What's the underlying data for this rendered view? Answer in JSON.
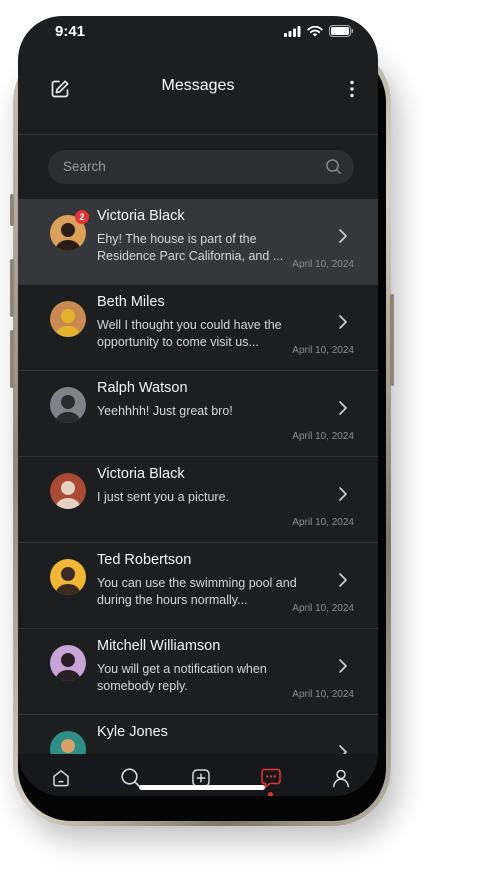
{
  "status_bar": {
    "time": "9:41"
  },
  "header": {
    "title": "Messages"
  },
  "search": {
    "placeholder": "Search"
  },
  "conversations": [
    {
      "name": "Victoria Black",
      "message": "Ehy! The house is part of the Residence Parc California, and ...",
      "date": "April 10, 2024",
      "unread": "2",
      "active": true,
      "avatar_bg": "#d9a15a",
      "avatar_fg": "#2b1d17"
    },
    {
      "name": "Beth Miles",
      "message": "Well I thought you could have the opportunity to come visit us...",
      "date": "April 10, 2024",
      "unread": "",
      "active": false,
      "avatar_bg": "#c98a52",
      "avatar_fg": "#e6b32f"
    },
    {
      "name": "Ralph Watson",
      "message": "Yeehhhh! Just great bro!",
      "date": "April 10, 2024",
      "unread": "",
      "active": false,
      "avatar_bg": "#7f8287",
      "avatar_fg": "#2a2b2e"
    },
    {
      "name": "Victoria Black",
      "message": "I just sent you a picture.",
      "date": "April 10, 2024",
      "unread": "",
      "active": false,
      "avatar_bg": "#a84a35",
      "avatar_fg": "#e5d2c3"
    },
    {
      "name": "Ted Robertson",
      "message": "You can use the swimming pool and during the hours normally...",
      "date": "April 10, 2024",
      "unread": "",
      "active": false,
      "avatar_bg": "#f0b735",
      "avatar_fg": "#3a2b22"
    },
    {
      "name": "Mitchell Williamson",
      "message": "You will get a notification when somebody reply.",
      "date": "April 10, 2024",
      "unread": "",
      "active": false,
      "avatar_bg": "#c7a5d9",
      "avatar_fg": "#2b1f25"
    },
    {
      "name": "Kyle Jones",
      "message": "",
      "date": "",
      "unread": "",
      "active": false,
      "avatar_bg": "#2f8f88",
      "avatar_fg": "#d8a16a"
    }
  ],
  "bottom_nav": [
    {
      "icon": "home-icon",
      "active": false
    },
    {
      "icon": "search-icon",
      "active": false
    },
    {
      "icon": "plus-square-icon",
      "active": false
    },
    {
      "icon": "chat-icon",
      "active": true
    },
    {
      "icon": "user-icon",
      "active": false
    }
  ],
  "colors": {
    "accent": "#e23434",
    "background": "#1d1e20",
    "active_row": "#35373a"
  }
}
